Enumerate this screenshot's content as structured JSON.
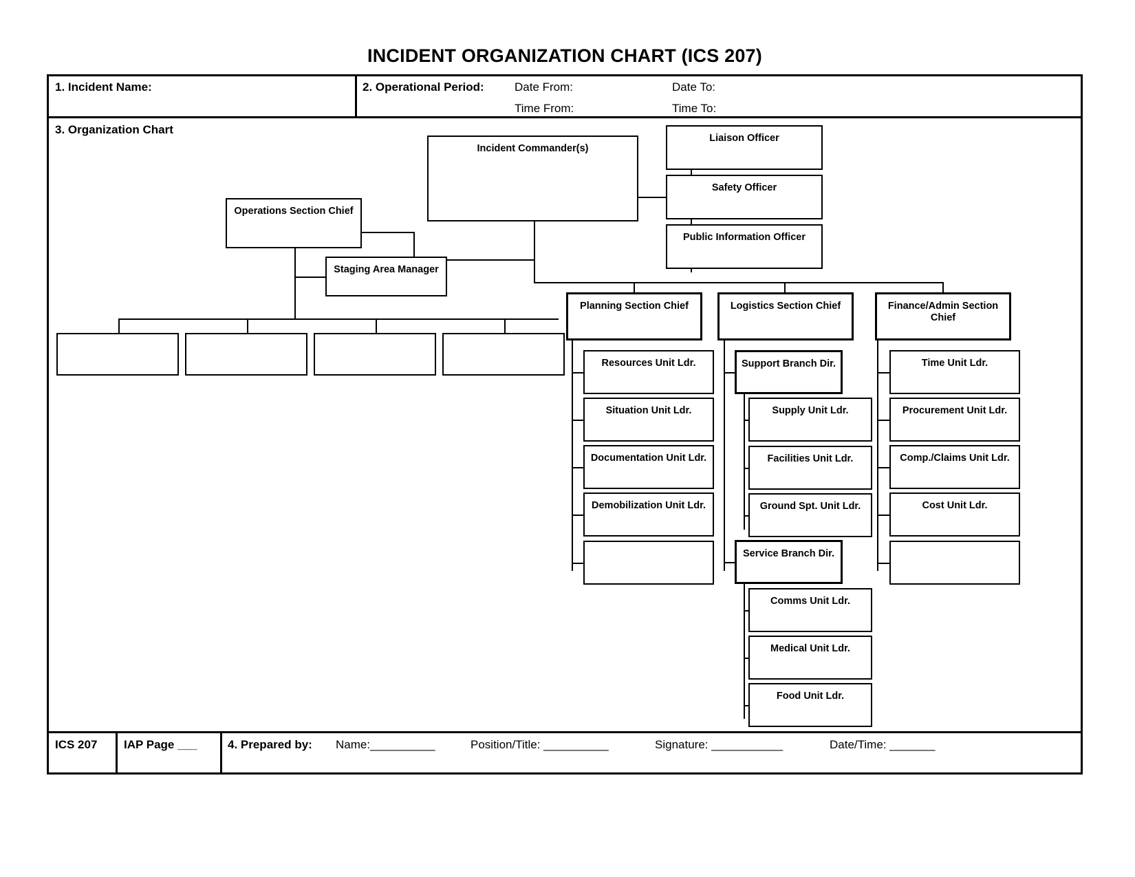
{
  "form": {
    "title": "INCIDENT ORGANIZATION CHART (ICS 207)",
    "header": {
      "incident_name_label": "1. Incident Name:",
      "operational_period_label": "2. Operational Period:",
      "date_from_label": "Date From:",
      "date_to_label": "Date To:",
      "time_from_label": "Time From:",
      "time_to_label": "Time To:",
      "incident_name_value": "",
      "date_from_value": "",
      "date_to_value": "",
      "time_from_value": "",
      "time_to_value": ""
    },
    "section3_label": "3. Organization Chart",
    "footer": {
      "form_id": "ICS 207",
      "iap_page_label": "IAP Page ___",
      "prepared_by_label": "4. Prepared by:",
      "name_label": "Name:__________",
      "position_title_label": "Position/Title: __________",
      "signature_label": "Signature: ___________",
      "date_time_label": "Date/Time: _______"
    }
  },
  "chart_data": {
    "type": "diagram",
    "title": "Incident Organization Chart",
    "nodes": {
      "incident_commander": "Incident Commander(s)",
      "liaison_officer": "Liaison Officer",
      "safety_officer": "Safety Officer",
      "public_information_officer": "Public Information Officer",
      "operations_section_chief": "Operations Section Chief",
      "staging_area_manager": "Staging Area Manager",
      "ops_branch_1": "",
      "ops_branch_2": "",
      "ops_branch_3": "",
      "ops_branch_4": "",
      "planning_section_chief": "Planning Section Chief",
      "resources_unit": "Resources Unit Ldr.",
      "situation_unit": "Situation Unit Ldr.",
      "documentation_unit": "Documentation Unit Ldr.",
      "demobilization_unit": "Demobilization Unit Ldr.",
      "planning_blank": "",
      "logistics_section_chief": "Logistics Section Chief",
      "support_branch_dir": "Support Branch Dir.",
      "supply_unit": "Supply Unit Ldr.",
      "facilities_unit": "Facilities Unit Ldr.",
      "ground_spt_unit": "Ground Spt. Unit Ldr.",
      "service_branch_dir": "Service Branch Dir.",
      "comms_unit": "Comms Unit Ldr.",
      "medical_unit": "Medical Unit Ldr.",
      "food_unit": "Food Unit Ldr.",
      "finance_admin_section_chief": "Finance/Admin Section Chief",
      "time_unit": "Time Unit Ldr.",
      "procurement_unit": "Procurement Unit Ldr.",
      "comp_claims_unit": "Comp./Claims Unit Ldr.",
      "cost_unit": "Cost Unit Ldr.",
      "finance_blank": ""
    }
  }
}
